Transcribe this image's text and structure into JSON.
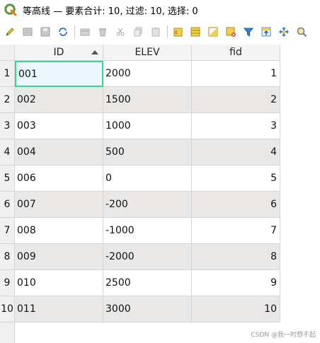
{
  "window": {
    "title": "等高线 — 要素合计: 10, 过滤: 10, 选择: 0"
  },
  "toolbar": {
    "buttons": [
      {
        "icon": "pencil-edit-icon"
      },
      {
        "icon": "multi-edit-icon"
      },
      {
        "icon": "save-icon"
      },
      {
        "icon": "reload-icon"
      },
      {
        "icon": "add-feature-icon"
      },
      {
        "icon": "delete-icon"
      },
      {
        "icon": "cut-icon"
      },
      {
        "icon": "copy-icon"
      },
      {
        "icon": "paste-icon"
      },
      {
        "icon": "expression-select-icon"
      },
      {
        "icon": "select-all-icon"
      },
      {
        "icon": "invert-selection-icon"
      },
      {
        "icon": "deselect-icon"
      },
      {
        "icon": "filter-icon"
      },
      {
        "icon": "move-selection-top-icon"
      },
      {
        "icon": "pan-to-selected-icon"
      },
      {
        "icon": "zoom-to-selected-icon"
      }
    ]
  },
  "table": {
    "columns": [
      "ID",
      "ELEV",
      "fid"
    ],
    "sorted_column": "ID",
    "rows": [
      {
        "num": "1",
        "id": "001",
        "elev": "2000",
        "fid": "1"
      },
      {
        "num": "2",
        "id": "002",
        "elev": "1500",
        "fid": "2"
      },
      {
        "num": "3",
        "id": "003",
        "elev": "1000",
        "fid": "3"
      },
      {
        "num": "4",
        "id": "004",
        "elev": "500",
        "fid": "4"
      },
      {
        "num": "5",
        "id": "006",
        "elev": "0",
        "fid": "5"
      },
      {
        "num": "6",
        "id": "007",
        "elev": "-200",
        "fid": "6"
      },
      {
        "num": "7",
        "id": "008",
        "elev": "-1000",
        "fid": "7"
      },
      {
        "num": "8",
        "id": "009",
        "elev": "-2000",
        "fid": "8"
      },
      {
        "num": "9",
        "id": "010",
        "elev": "2500",
        "fid": "9"
      },
      {
        "num": "10",
        "id": "011",
        "elev": "3000",
        "fid": "10"
      }
    ]
  },
  "watermark": "CSDN @我一时想不起",
  "colors": {
    "selection_border": "#3bd68c",
    "alt_row": "#e9e8e6",
    "qgis_green": "#589632"
  }
}
